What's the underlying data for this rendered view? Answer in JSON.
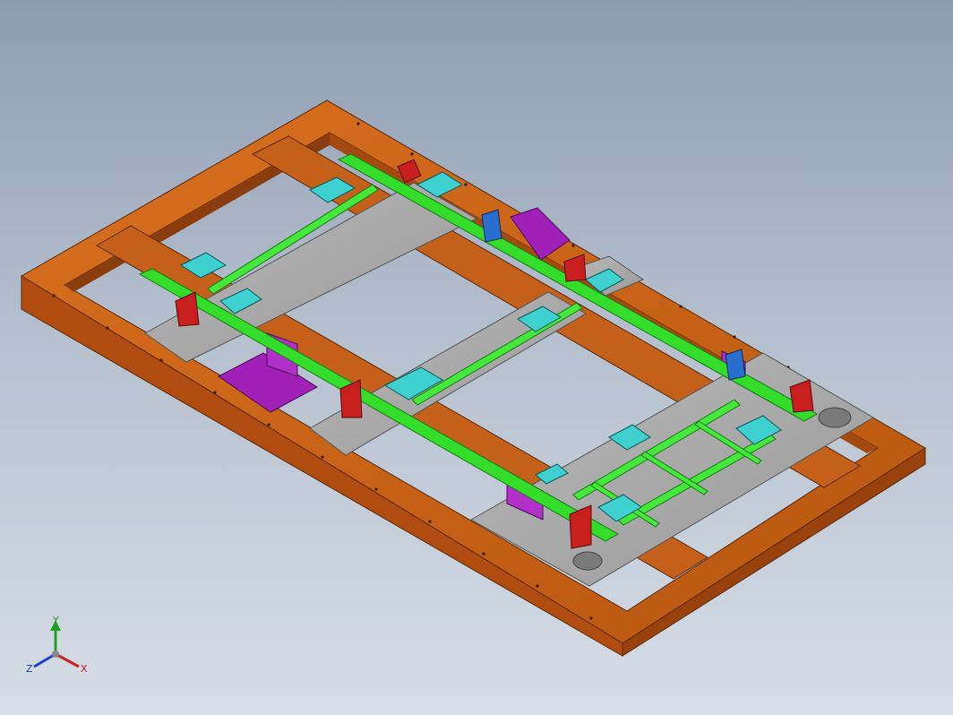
{
  "viewport": {
    "background_top": "#8e9cb2",
    "background_bottom": "#d6dde6"
  },
  "model": {
    "frame_color": "#c8601a",
    "frame_dark": "#8a3c0c",
    "plate_color": "#a8a8a8",
    "rail_color": "#33dd2a",
    "block_color": "#3fd0d0",
    "clamp_color": "#c81e1e",
    "bracket_color": "#a020b8",
    "stand_color": "#2a6fd0"
  },
  "triad": {
    "x_label": "X",
    "y_label": "Y",
    "z_label": "Z",
    "x_color": "#d02020",
    "y_color": "#20a020",
    "z_color": "#2040d0"
  }
}
